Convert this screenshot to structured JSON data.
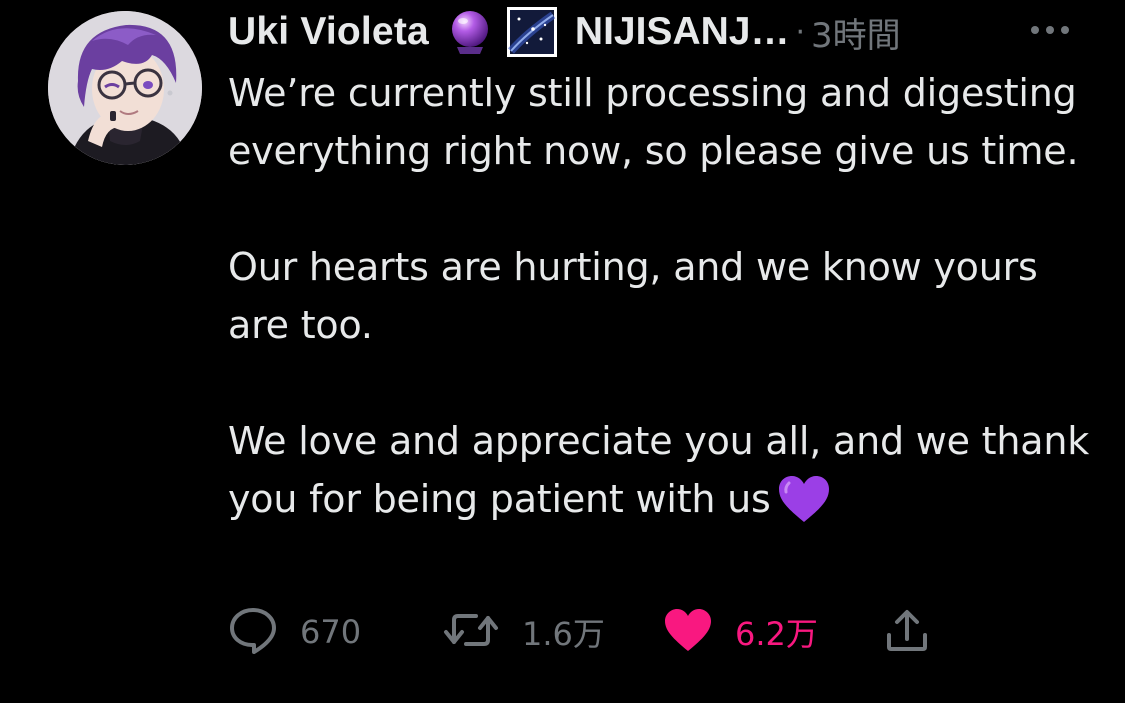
{
  "tweet": {
    "author": {
      "display_name": "Uki Violeta",
      "name_emojis": [
        "crystal-ball",
        "milky-way"
      ],
      "handle": "NIJISANJ…"
    },
    "separator": "·",
    "time": "3時間",
    "body": [
      "We’re currently still processing and digesting everything right now, so please give us time.",
      "Our hearts are hurting, and we know yours are too.",
      "We love and appreciate you all, and we thank you for being patient with us"
    ],
    "trailing_emoji": "purple-heart",
    "actions": {
      "reply": {
        "icon": "reply-icon",
        "count": "670"
      },
      "retweet": {
        "icon": "retweet-icon",
        "count": "1.6万"
      },
      "like": {
        "icon": "heart-icon",
        "count": "6.2万",
        "liked": true
      },
      "share": {
        "icon": "share-icon"
      }
    }
  },
  "colors": {
    "background": "#000000",
    "text": "#e7e9ea",
    "muted": "#71767b",
    "like": "#f91880",
    "purple_heart": "#9b3fe6"
  }
}
